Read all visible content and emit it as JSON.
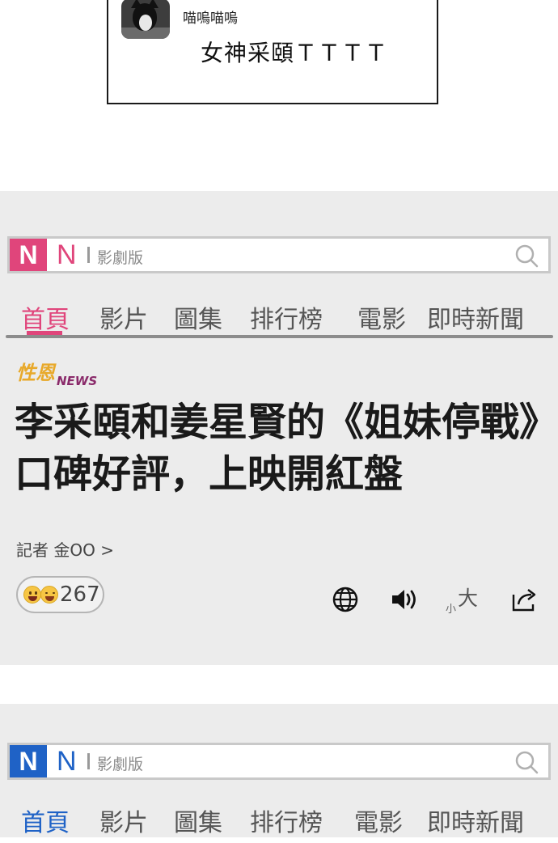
{
  "comment": {
    "username": "喵嗚喵嗚",
    "text": "女神采頤ＴＴＴＴ"
  },
  "site": {
    "logo_letter": "N",
    "section": "影劇版",
    "colors": {
      "logo_primary": "#e0457b",
      "logo_secondary": "#1f62c6",
      "nav_active": "#e0457b"
    }
  },
  "nav": {
    "items": [
      "首頁",
      "影片",
      "圖集",
      "排行榜",
      "電影",
      "即時新聞"
    ],
    "active": "首頁"
  },
  "article": {
    "brand": "性恩",
    "brand_suffix": "NEWS",
    "headline_line1": "李采頤和姜星賢的《姐妹停戰》",
    "headline_line2": "口碑好評，上映開紅盤",
    "reporter": "記者 金OO >",
    "reaction_count": "267",
    "font_size_small": "小",
    "font_size_big": "大",
    "tools": [
      "globe-icon",
      "speaker-icon",
      "font-size-icon",
      "share-icon"
    ]
  }
}
